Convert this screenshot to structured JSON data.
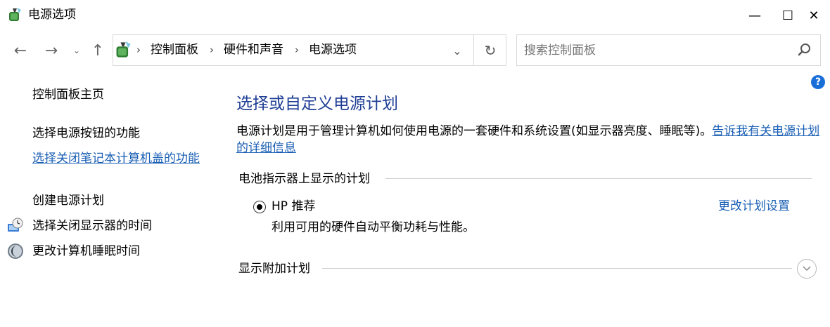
{
  "window": {
    "title": "电源选项",
    "minimize_glyph": "—",
    "maximize_glyph": "☐",
    "close_glyph": "✕"
  },
  "nav": {
    "back_glyph": "←",
    "forward_glyph": "→",
    "recent_glyph": "⌄",
    "up_glyph": "↑",
    "dropdown_glyph": "⌄",
    "refresh_glyph": "↻",
    "breadcrumb": [
      "控制面板",
      "硬件和声音",
      "电源选项"
    ],
    "separator": "›"
  },
  "search": {
    "placeholder": "搜索控制面板"
  },
  "help": {
    "glyph": "?"
  },
  "left_pane": {
    "home": "控制面板主页",
    "links": {
      "power_button": "选择电源按钮的功能",
      "lid": "选择关闭笔记本计算机盖的功能",
      "create_plan": "创建电源计划",
      "display_off": "选择关闭显示器的时间",
      "sleep": "更改计算机睡眠时间"
    }
  },
  "main": {
    "heading": "选择或自定义电源计划",
    "description": "电源计划是用于管理计算机如何使用电源的一套硬件和系统设置(如显示器亮度、睡眠等)。",
    "description_link": "告诉我有关电源计划的详细信息",
    "battery_section": "电池指示器上显示的计划",
    "plan": {
      "name": "HP 推荐",
      "description": "利用可用的硬件自动平衡功耗与性能。",
      "selected": true,
      "change_link": "更改计划设置"
    },
    "additional_section": "显示附加计划"
  },
  "icons": {
    "app": "power-options-icon",
    "address": "power-options-icon",
    "search": "search-icon",
    "display": "display-clock-icon",
    "sleep": "moon-icon",
    "expand": "chevron-down-icon"
  },
  "colors": {
    "link": "#1a5fb4",
    "heading": "#1f3e95",
    "help": "#1a6ed8"
  }
}
